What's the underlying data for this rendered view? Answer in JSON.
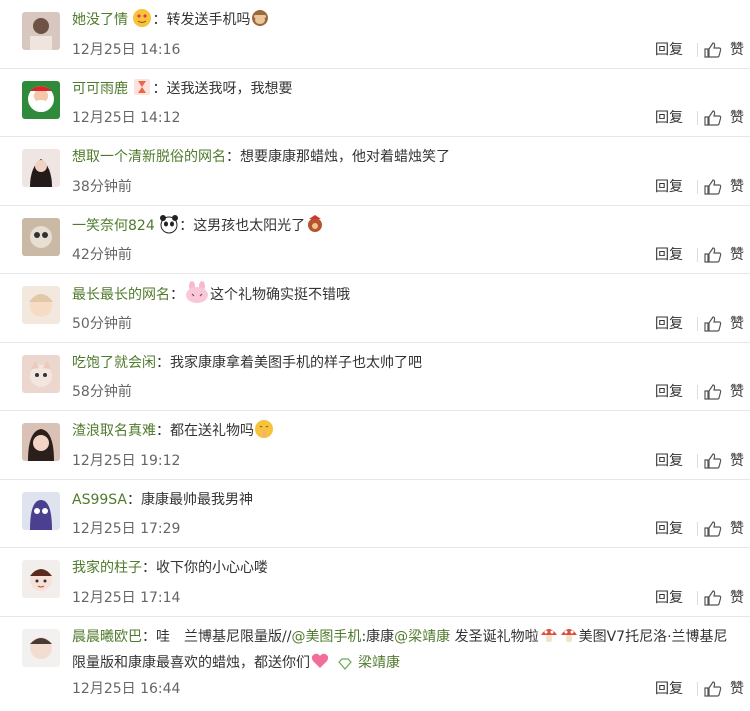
{
  "reply_label": "回复",
  "like_label": "赞",
  "comments": [
    {
      "user": "她没了情",
      "text": "转发送手机吗",
      "time": "12月25日 14:16"
    },
    {
      "user": "可可雨鹿",
      "text": "送我送我呀，我想要",
      "time": "12月25日 14:12"
    },
    {
      "user": "想取一个清新脱俗的网名",
      "text": "想要康康那蜡烛，他对着蜡烛笑了",
      "time": "38分钟前"
    },
    {
      "user": "一笑奈何824",
      "text": "这男孩也太阳光了",
      "time": "42分钟前"
    },
    {
      "user": "最长最长的网名",
      "text": "这个礼物确实挺不错哦",
      "time": "50分钟前"
    },
    {
      "user": "吃饱了就会闲",
      "text": "我家康康拿着美图手机的样子也太帅了吧",
      "time": "58分钟前"
    },
    {
      "user": "渣浪取名真难",
      "text": "都在送礼物吗",
      "time": "12月25日 19:12"
    },
    {
      "user": "AS99SA",
      "text": "康康最帅最我男神",
      "time": "12月25日 17:29"
    },
    {
      "user": "我家的柱子",
      "text": "收下你的小心心喽",
      "time": "12月25日 17:14"
    }
  ],
  "last_comment": {
    "user": "晨晨曦欧巴",
    "seg1": "哇　兰博基尼限量版//",
    "mention1": "@美图手机",
    "seg2": ":康康",
    "mention2": "@梁靖康",
    "seg3": " 发圣诞礼物啦",
    "seg4": "美图V7托尼洛·兰博基尼限量版和康康最喜欢的蜡烛，都送你们",
    "badge_name": "梁靖康",
    "time": "12月25日 16:44"
  },
  "colors": {
    "username": "#507a2d",
    "divider": "#e6e6e6",
    "meta": "#666666"
  }
}
